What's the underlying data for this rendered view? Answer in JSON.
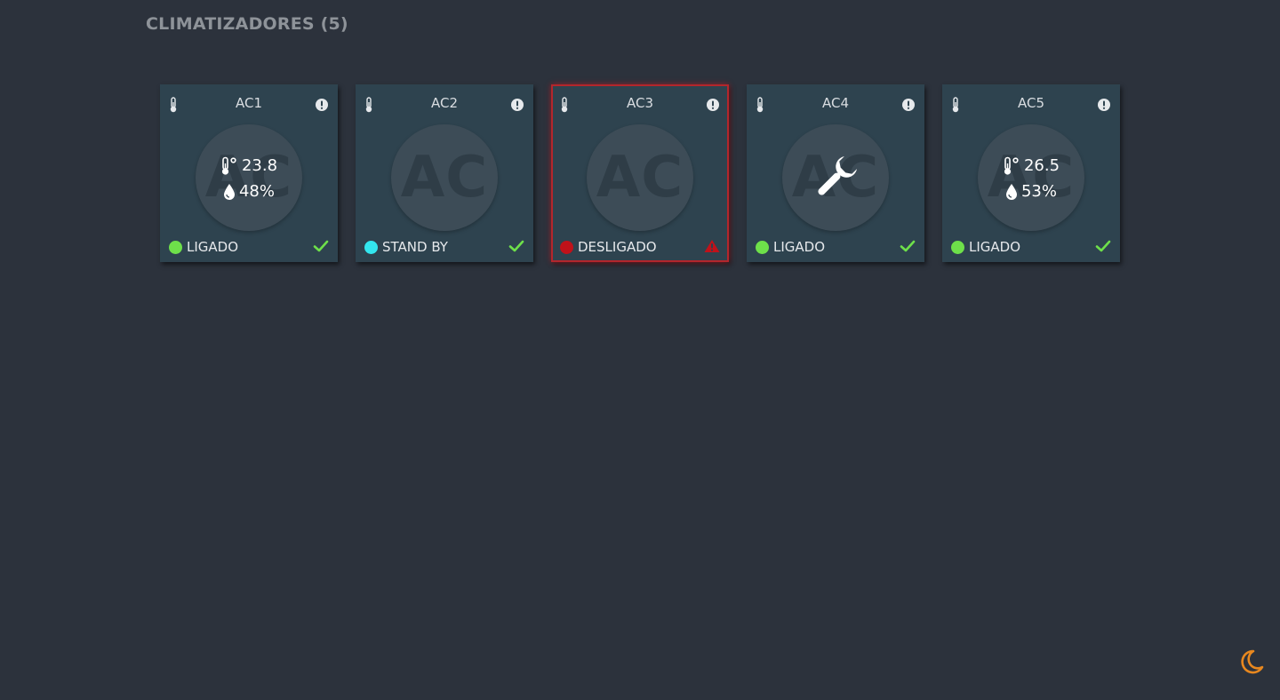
{
  "header": {
    "title": "CLIMATIZADORES (5)"
  },
  "colors": {
    "on": "#6ee04a",
    "standby": "#33e6ee",
    "off": "#c0121a",
    "ok_check": "#6ee04a",
    "warning": "#c0121a",
    "moon": "#e8881f"
  },
  "cards": [
    {
      "name": "AC1",
      "watermark": "AC",
      "temperature": "23.8",
      "humidity": "48%",
      "status_label": "LIGADO",
      "status": "on",
      "indicator": "check-icon",
      "alarm": false,
      "center": "readings"
    },
    {
      "name": "AC2",
      "watermark": "AC",
      "status_label": "STAND BY",
      "status": "standby",
      "indicator": "check-icon",
      "alarm": false,
      "center": "watermark"
    },
    {
      "name": "AC3",
      "watermark": "AC",
      "status_label": "DESLIGADO",
      "status": "off",
      "indicator": "warning-icon",
      "alarm": true,
      "center": "watermark"
    },
    {
      "name": "AC4",
      "watermark": "AC",
      "status_label": "LIGADO",
      "status": "on",
      "indicator": "check-icon",
      "alarm": false,
      "center": "wrench-icon"
    },
    {
      "name": "AC5",
      "watermark": "AC",
      "temperature": "26.5",
      "humidity": "53%",
      "status_label": "LIGADO",
      "status": "on",
      "indicator": "check-icon",
      "alarm": false,
      "center": "readings"
    }
  ],
  "theme_toggle": {
    "icon": "moon-icon"
  }
}
